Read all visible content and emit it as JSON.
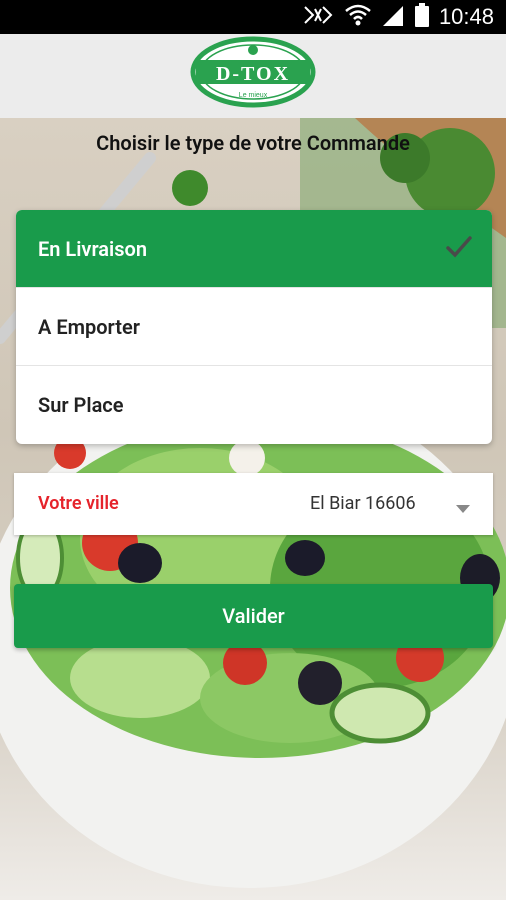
{
  "status_bar": {
    "time": "10:48"
  },
  "header": {
    "logo_text": "D-TOX",
    "logo_small_text": "Le mieux"
  },
  "title": "Choisir le type de votre Commande",
  "order_types": [
    {
      "label": "En Livraison",
      "selected": true
    },
    {
      "label": "A Emporter",
      "selected": false
    },
    {
      "label": "Sur Place",
      "selected": false
    }
  ],
  "city": {
    "label": "Votre ville",
    "value": "El Biar 16606"
  },
  "validate_label": "Valider",
  "colors": {
    "primary_green": "#199b4b",
    "label_red": "#e5232b"
  }
}
